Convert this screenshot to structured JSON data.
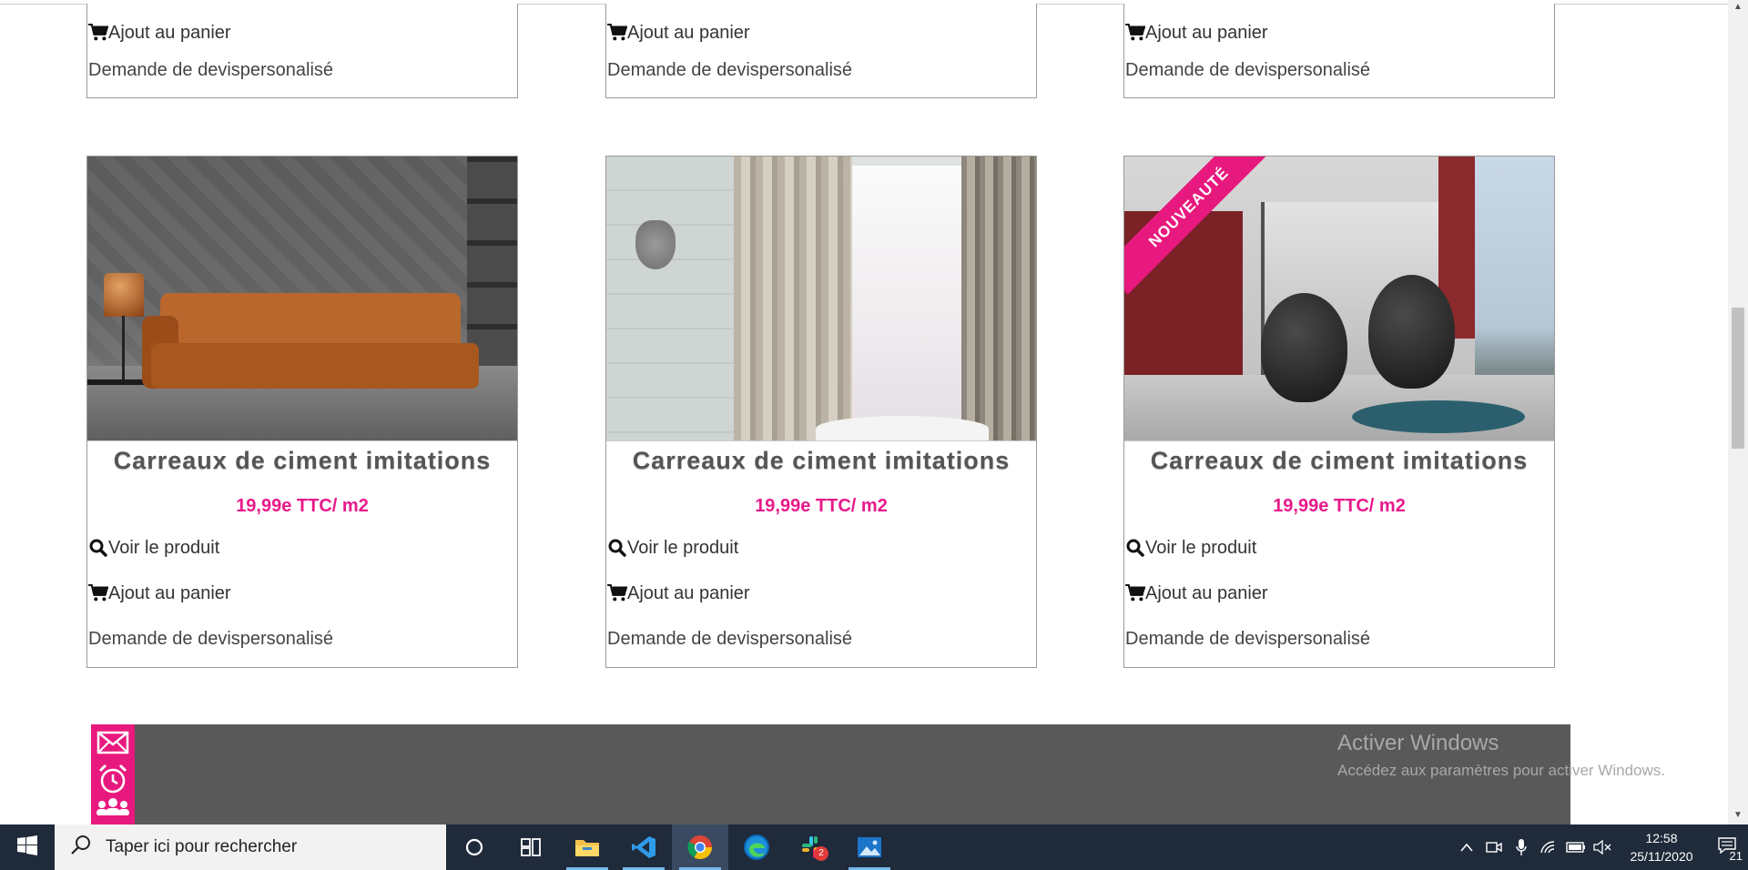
{
  "actions": {
    "view": "Voir le produit",
    "cart": "Ajout au panier",
    "quote": "Demande de devispersonalisé"
  },
  "products_top": [
    {
      "cart": "Ajout au panier",
      "quote": "Demande de devispersonalisé"
    },
    {
      "cart": "Ajout au panier",
      "quote": "Demande de devispersonalisé"
    },
    {
      "cart": "Ajout au panier",
      "quote": "Demande de devispersonalisé"
    }
  ],
  "products": [
    {
      "title": "Carreaux de ciment imitations",
      "price": "19,99e TTC/ m2",
      "badge": ""
    },
    {
      "title": "Carreaux de ciment imitations",
      "price": "19,99e TTC/ m2",
      "badge": ""
    },
    {
      "title": "Carreaux de ciment imitations",
      "price": "19,99e TTC/ m2",
      "badge": "NOUVEAUTÉ"
    }
  ],
  "colors": {
    "accent": "#e8197e",
    "price": "#e8198b",
    "footer": "#595959",
    "taskbar": "#1f2a3a"
  },
  "footer_icons": [
    "mail-icon",
    "alarm-clock-icon",
    "people-icon"
  ],
  "watermark": {
    "title": "Activer Windows",
    "subtitle": "Accédez aux paramètres pour activer Windows."
  },
  "taskbar": {
    "search_placeholder": "Taper ici pour rechercher",
    "apps": [
      "cortana-icon",
      "task-view-icon",
      "file-explorer-icon",
      "vscode-icon",
      "chrome-icon",
      "edge-icon",
      "slack-icon",
      "photos-icon"
    ],
    "slack_badge": "2",
    "time": "12:58",
    "date": "25/11/2020",
    "notifications": "21"
  }
}
